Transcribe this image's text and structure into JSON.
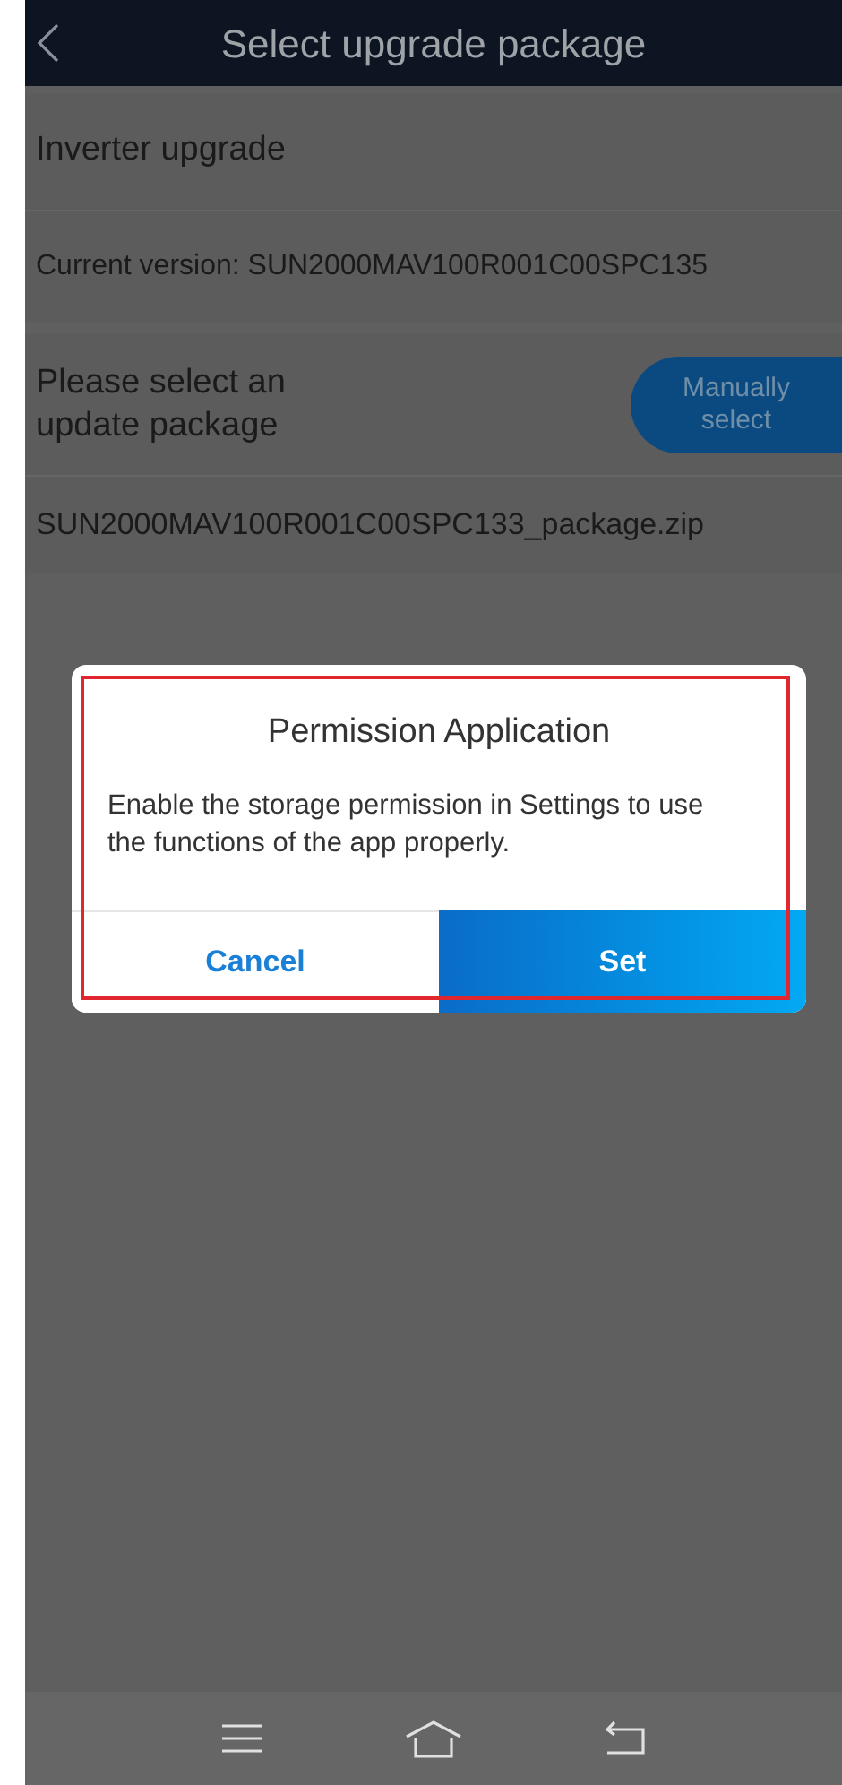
{
  "header": {
    "title": "Select upgrade package"
  },
  "section_title": "Inverter upgrade",
  "current_version": "Current version: SUN2000MAV100R001C00SPC135",
  "select_row": {
    "label": "Please select an update package",
    "button": "Manually select"
  },
  "package_file": "SUN2000MAV100R001C00SPC133_package.zip",
  "dialog": {
    "title": "Permission Application",
    "message": "Enable the storage permission in Settings to use the functions of the app properly.",
    "highlighted": true,
    "buttons": [
      {
        "label": "Cancel",
        "kind": "secondary"
      },
      {
        "label": "Set",
        "kind": "primary"
      }
    ]
  }
}
